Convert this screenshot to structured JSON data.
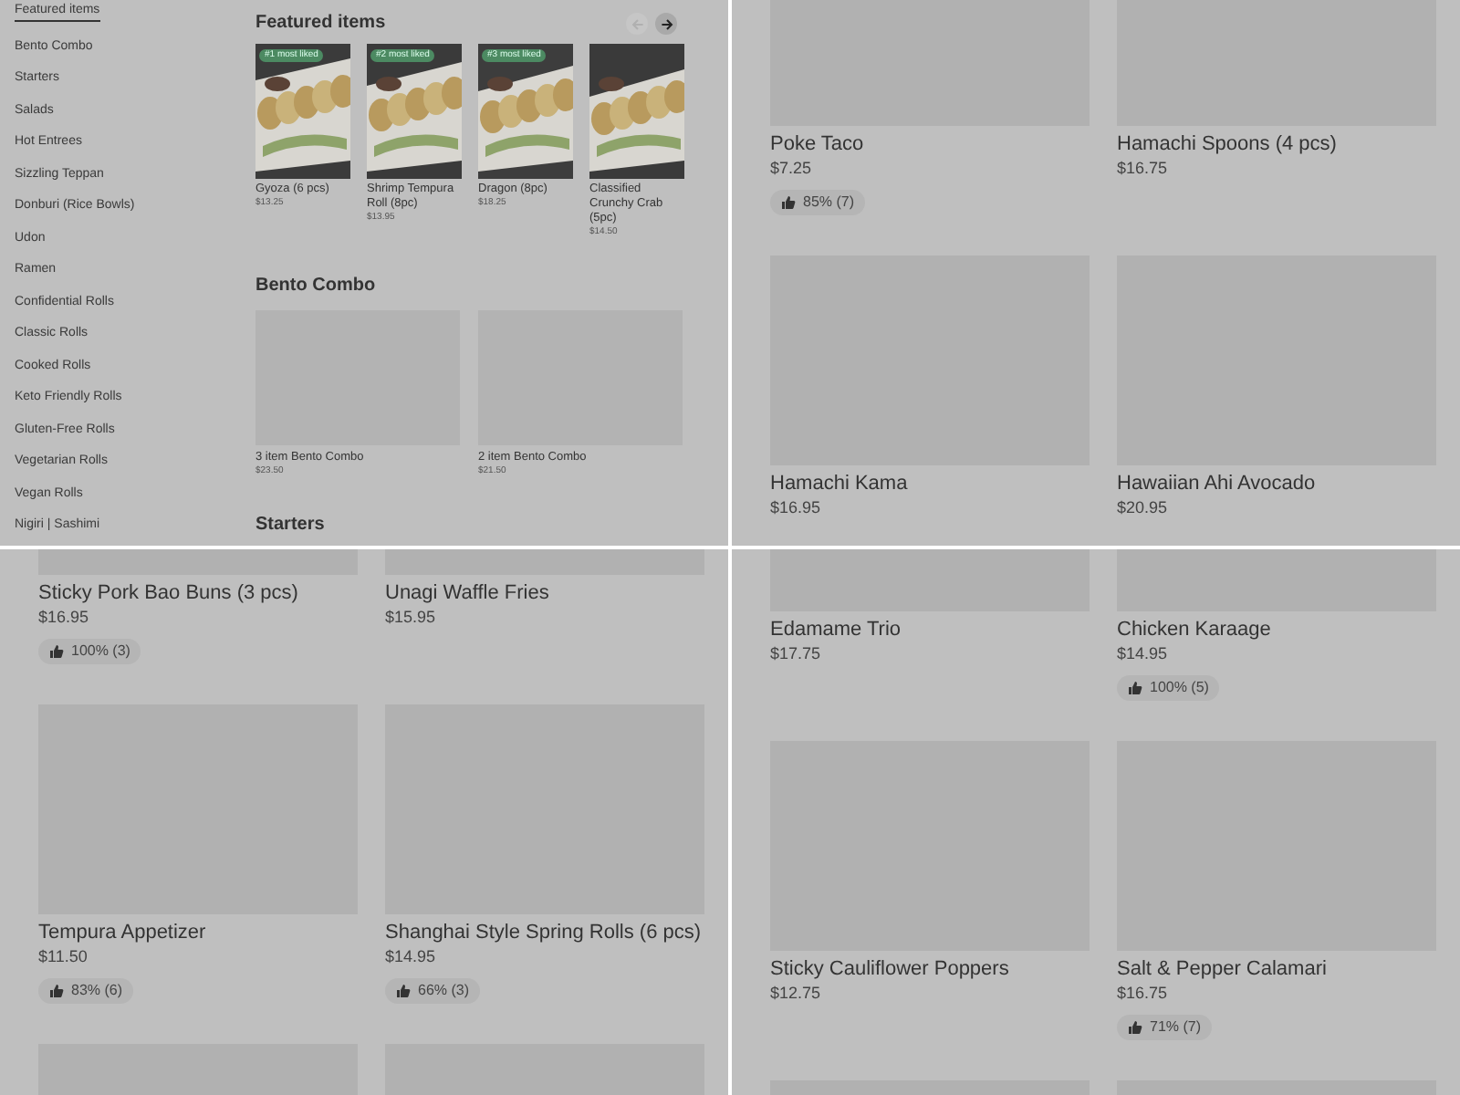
{
  "panels": [
    {
      "kind": "menu",
      "sidebar": {
        "items": [
          {
            "label": "Featured items",
            "selected": true
          },
          {
            "label": "Bento Combo",
            "selected": false
          },
          {
            "label": "Starters",
            "selected": false
          },
          {
            "label": "Salads",
            "selected": false
          },
          {
            "label": "Hot Entrees",
            "selected": false
          },
          {
            "label": "Sizzling Teppan",
            "selected": false
          },
          {
            "label": "Donburi (Rice Bowls)",
            "selected": false
          },
          {
            "label": "Udon",
            "selected": false
          },
          {
            "label": "Ramen",
            "selected": false
          },
          {
            "label": "Confidential Rolls",
            "selected": false
          },
          {
            "label": "Classic Rolls",
            "selected": false
          },
          {
            "label": "Cooked Rolls",
            "selected": false
          },
          {
            "label": "Keto Friendly Rolls",
            "selected": false
          },
          {
            "label": "Gluten-Free Rolls",
            "selected": false
          },
          {
            "label": "Vegetarian Rolls",
            "selected": false
          },
          {
            "label": "Vegan Rolls",
            "selected": false
          },
          {
            "label": "Nigiri | Sashimi",
            "selected": false
          }
        ]
      },
      "featured": {
        "title": "Featured items",
        "buttons": [
          {
            "kind": "prev",
            "disabled": true
          },
          {
            "kind": "next",
            "disabled": false
          }
        ],
        "items": [
          {
            "badge": "#1 most liked",
            "name": "Gyoza (6 pcs)",
            "price": "$13.25"
          },
          {
            "badge": "#2 most liked",
            "name": "Shrimp Tempura Roll  (8pc)",
            "price": "$13.95"
          },
          {
            "badge": "#3 most liked",
            "name": "Dragon (8pc)",
            "price": "$18.25"
          },
          {
            "name": "Classified Crunchy Crab (5pc)",
            "price": "$14.50"
          }
        ]
      },
      "sections": [
        {
          "title": "Bento Combo",
          "items": [
            {
              "name": "3 item Bento Combo",
              "price": "$23.50"
            },
            {
              "name": "2 item Bento Combo",
              "price": "$21.50"
            }
          ]
        },
        {
          "title": "Starters"
        }
      ]
    },
    {
      "kind": "grid",
      "items": [
        {
          "kind": "dish",
          "name": "Poke Taco",
          "price": "$7.25",
          "rating": "85% (7)"
        },
        {
          "kind": "dish",
          "name": "Hamachi Spoons (4 pcs)",
          "price": "$16.75"
        },
        {
          "kind": "dish",
          "name": "Hamachi Kama",
          "price": "$16.95"
        },
        {
          "kind": "dish",
          "name": "Hawaiian Ahi Avocado",
          "price": "$20.95"
        }
      ]
    },
    {
      "kind": "grid",
      "items": [
        {
          "kind": "dish",
          "name": "Sticky Pork Bao Buns (3 pcs)",
          "price": "$16.95",
          "rating": "100% (3)"
        },
        {
          "kind": "dish",
          "name": "Unagi Waffle Fries",
          "price": "$15.95"
        },
        {
          "kind": "dish",
          "name": "Tempura Appetizer",
          "price": "$11.50",
          "rating": "83% (6)"
        },
        {
          "kind": "dish",
          "name": "Shanghai Style Spring Rolls (6 pcs)",
          "price": "$14.95",
          "rating": "66% (3)"
        },
        {
          "kind": "image_only"
        },
        {
          "kind": "image_only"
        }
      ]
    },
    {
      "kind": "grid",
      "items": [
        {
          "kind": "dish",
          "name": "Edamame Trio",
          "price": "$17.75"
        },
        {
          "kind": "dish",
          "name": "Chicken Karaage",
          "price": "$14.95",
          "rating": "100% (5)"
        },
        {
          "kind": "dish",
          "name": "Sticky Cauliflower Poppers",
          "price": "$12.75"
        },
        {
          "kind": "dish",
          "name": "Salt & Pepper Calamari",
          "price": "$16.75",
          "rating": "71% (7)"
        },
        {
          "kind": "image_only"
        },
        {
          "kind": "image_only"
        }
      ]
    }
  ]
}
